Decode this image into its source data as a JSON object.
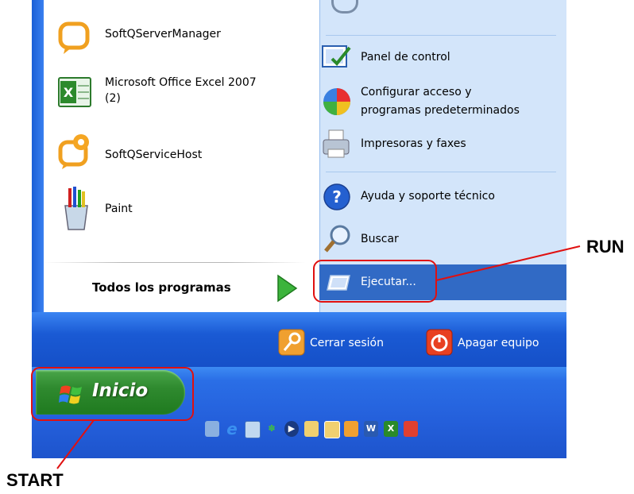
{
  "left_items": [
    {
      "label": "SoftQServerManager",
      "icon": "softq-server-manager-icon"
    },
    {
      "label": "Microsoft Office Excel 2007",
      "label2": "(2)",
      "icon": "excel-icon"
    },
    {
      "label": "SoftQServiceHost",
      "icon": "softq-service-host-icon"
    },
    {
      "label": "Paint",
      "icon": "paint-icon"
    }
  ],
  "all_programs": "Todos los programas",
  "right_items": {
    "control_panel": "Panel de control",
    "config_line1": "Configurar acceso y",
    "config_line2": "programas predeterminados",
    "printers": "Impresoras y faxes",
    "help": "Ayuda y soporte técnico",
    "search": "Buscar",
    "run": "Ejecutar..."
  },
  "bottom": {
    "logoff": "Cerrar sesión",
    "shutdown": "Apagar equipo"
  },
  "start_button": "Inicio",
  "annotations": {
    "run": "RUN",
    "start": "START"
  },
  "quick_launch_icons": [
    "show-desktop-icon",
    "internet-explorer-icon",
    "app-icon",
    "msn-icon",
    "media-player-icon",
    "folder-icon",
    "folder-2-icon",
    "outlook-icon",
    "word-icon",
    "excel-small-icon",
    "app-red-icon"
  ],
  "colors": {
    "accent_blue": "#2563d9",
    "highlight": "#316ac5",
    "annotation_red": "#e01010",
    "start_green": "#2f8a2f"
  }
}
